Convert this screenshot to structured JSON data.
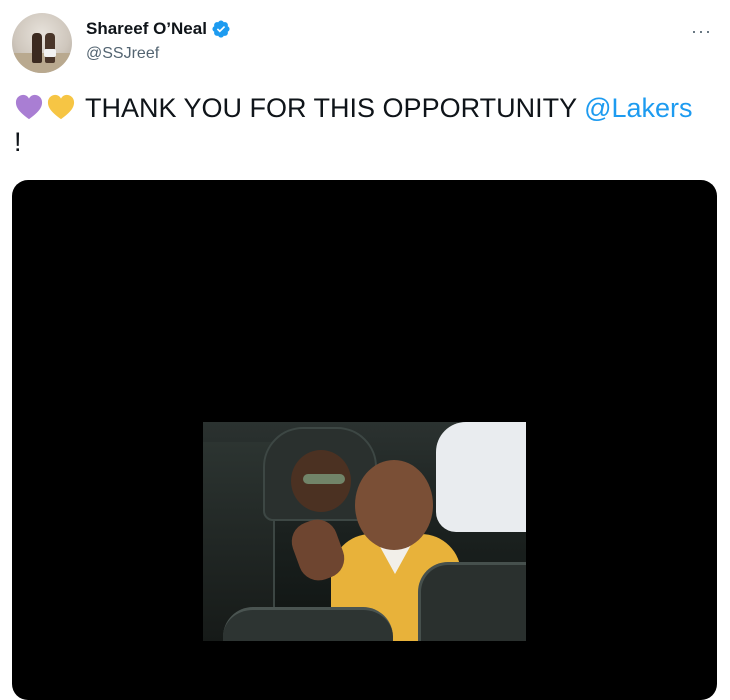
{
  "author": {
    "display_name": "Shareef O’Neal",
    "handle": "@SSJreef",
    "verified": true,
    "avatar_icon": "profile-photo"
  },
  "more_icon": "more-horizontal-icon",
  "more_glyph": "···",
  "tweet": {
    "emoji": [
      "purple-heart",
      "yellow-heart"
    ],
    "text": "THANK YOU FOR THIS OPPORTUNITY ",
    "mention": "@Lakers",
    "suffix": "!"
  },
  "colors": {
    "link": "#1d9bf0",
    "verified": "#1d9bf0",
    "purple_heart": "#a97ed3",
    "yellow_heart": "#f6c544"
  }
}
